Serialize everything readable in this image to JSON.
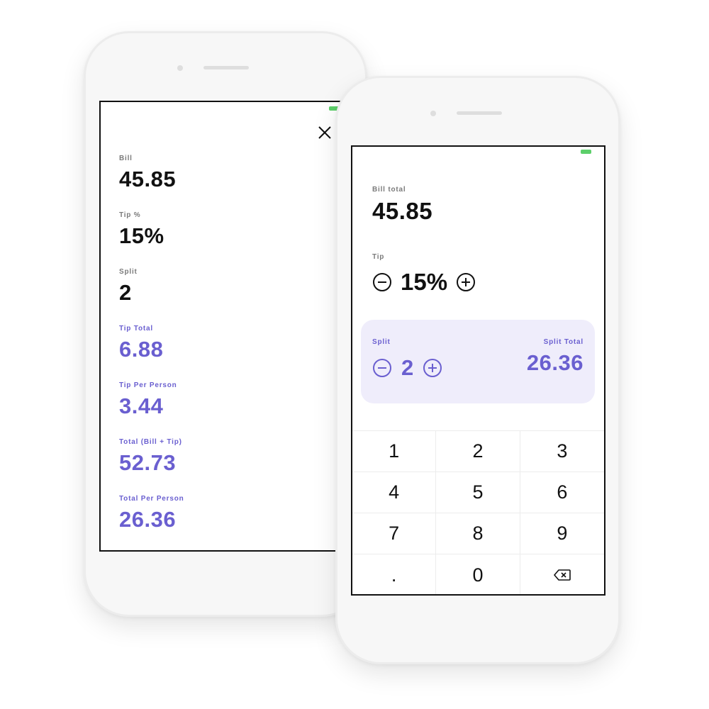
{
  "results_screen": {
    "close_icon": "close-icon",
    "fields": [
      {
        "label": "Bill",
        "value": "45.85"
      },
      {
        "label": "Tip %",
        "value": "15%"
      },
      {
        "label": "Split",
        "value": "2"
      },
      {
        "label": "Tip Total",
        "value": "6.88"
      },
      {
        "label": "Tip Per Person",
        "value": "3.44"
      },
      {
        "label": "Total (Bill + Tip)",
        "value": "52.73"
      },
      {
        "label": "Total Per Person",
        "value": "26.36"
      }
    ]
  },
  "calculator_screen": {
    "bill_label": "Bill total",
    "bill_value": "45.85",
    "tip_label": "Tip",
    "tip_value": "15%",
    "split_label": "Split",
    "split_value": "2",
    "split_total_label": "Split Total",
    "split_total_value": "26.36",
    "keys": [
      "1",
      "2",
      "3",
      "4",
      "5",
      "6",
      "7",
      "8",
      "9",
      ".",
      "0"
    ],
    "backspace_icon": "backspace-icon"
  },
  "colors": {
    "accent": "#6a5fd0",
    "split_card_bg": "#efedfb",
    "battery": "#5ccf6a"
  }
}
